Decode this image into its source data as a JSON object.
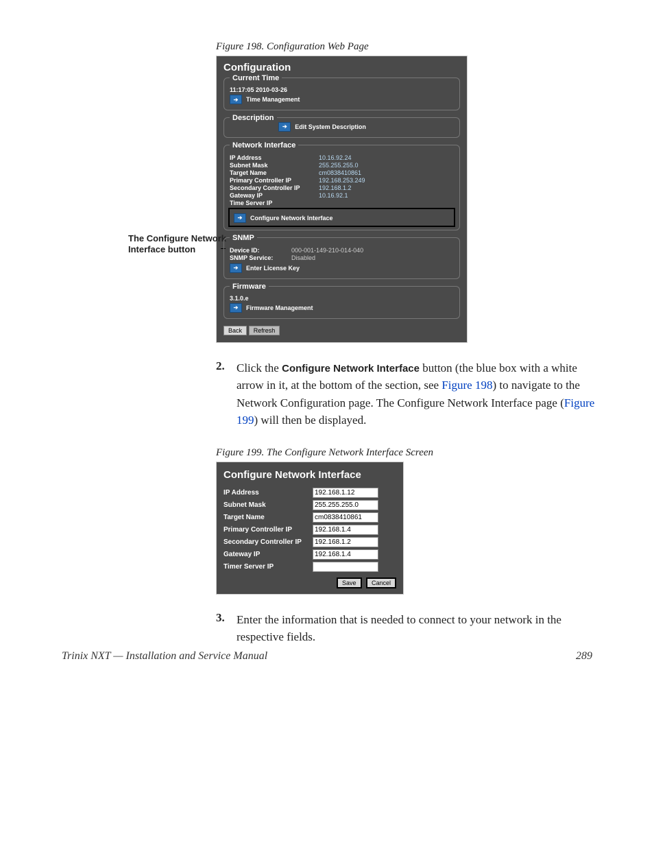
{
  "fig198": {
    "caption": "Figure 198.  Configuration Web Page",
    "title": "Configuration",
    "current_time": {
      "legend": "Current Time",
      "value": "11:17:05 2010-03-26",
      "button": "Time Management"
    },
    "description": {
      "legend": "Description",
      "button": "Edit System Description"
    },
    "network": {
      "legend": "Network Interface",
      "rows": {
        "ip_k": "IP Address",
        "ip_v": "10.16.92.24",
        "sm_k": "Subnet Mask",
        "sm_v": "255.255.255.0",
        "tn_k": "Target Name",
        "tn_v": "cm0838410861",
        "pc_k": "Primary Controller IP",
        "pc_v": "192.168.253.249",
        "sc_k": "Secondary Controller IP",
        "sc_v": "192.168.1.2",
        "gw_k": "Gateway IP",
        "gw_v": "10.16.92.1",
        "ts_k": "Time Server IP",
        "ts_v": ""
      },
      "button": "Configure Network Interface"
    },
    "snmp": {
      "legend": "SNMP",
      "rows": {
        "did_k": "Device ID:",
        "did_v": "000-001-149-210-014-040",
        "svc_k": "SNMP Service:",
        "svc_v": "Disabled"
      },
      "button": "Enter License Key"
    },
    "firmware": {
      "legend": "Firmware",
      "version": "3.1.0.e",
      "button": "Firmware Management"
    },
    "back": "Back",
    "refresh": "Refresh"
  },
  "callout": "The Configure Network Interface button",
  "step2": {
    "num": "2.",
    "pre": "Click the ",
    "bold": "Configure Network Interface",
    "mid1": " button (the blue box with a white arrow in it, at the bottom of the section, see ",
    "link1": "Figure 198",
    "mid2": ") to navigate to the Network Configuration page. The Configure Network Interface page (",
    "link2": "Figure 199",
    "post": ") will then be displayed."
  },
  "fig199": {
    "caption": "Figure 199.  The Configure Network Interface Screen",
    "title": "Configure Network Interface",
    "rows": {
      "ip_l": "IP Address",
      "ip_v": "192.168.1.12",
      "sm_l": "Subnet Mask",
      "sm_v": "255.255.255.0",
      "tn_l": "Target Name",
      "tn_v": "cm0838410861",
      "pc_l": "Primary Controller IP",
      "pc_v": "192.168.1.4",
      "sc_l": "Secondary Controller IP",
      "sc_v": "192.168.1.2",
      "gw_l": "Gateway IP",
      "gw_v": "192.168.1.4",
      "ts_l": "Timer Server IP",
      "ts_v": ""
    },
    "save": "Save",
    "cancel": "Cancel"
  },
  "step3": {
    "num": "3.",
    "text": "Enter the information that is needed to connect to your network in the respective fields."
  },
  "footer": {
    "left": "Trinix NXT  —  Installation and Service Manual",
    "right": "289"
  }
}
